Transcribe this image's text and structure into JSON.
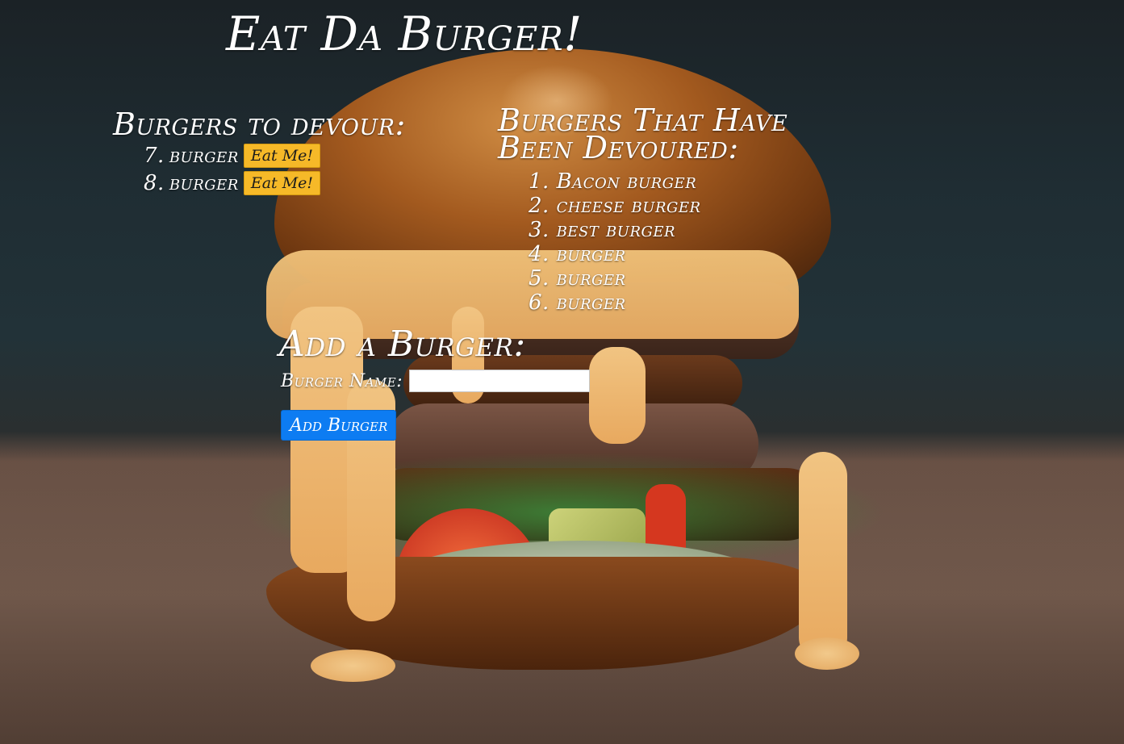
{
  "page": {
    "title": "Eat Da Burger!"
  },
  "to_devour": {
    "heading": "Burgers to devour:",
    "button_label": "Eat Me!",
    "items": [
      {
        "num": "7.",
        "name": "burger"
      },
      {
        "num": "8.",
        "name": "burger"
      }
    ]
  },
  "devoured": {
    "heading": "Burgers That Have Been Devoured:",
    "items": [
      "1. Bacon burger",
      "2. cheese burger",
      "3. best burger",
      "4. burger",
      "5. burger",
      "6. burger"
    ]
  },
  "add_form": {
    "heading": "Add a Burger:",
    "label": "Burger Name:",
    "input_value": "",
    "button_label": "Add Burger"
  },
  "colors": {
    "eat_button": "#f6b928",
    "add_button": "#0d7cf2",
    "text": "#ffffff"
  },
  "background": {
    "icon": "burger-photo"
  }
}
